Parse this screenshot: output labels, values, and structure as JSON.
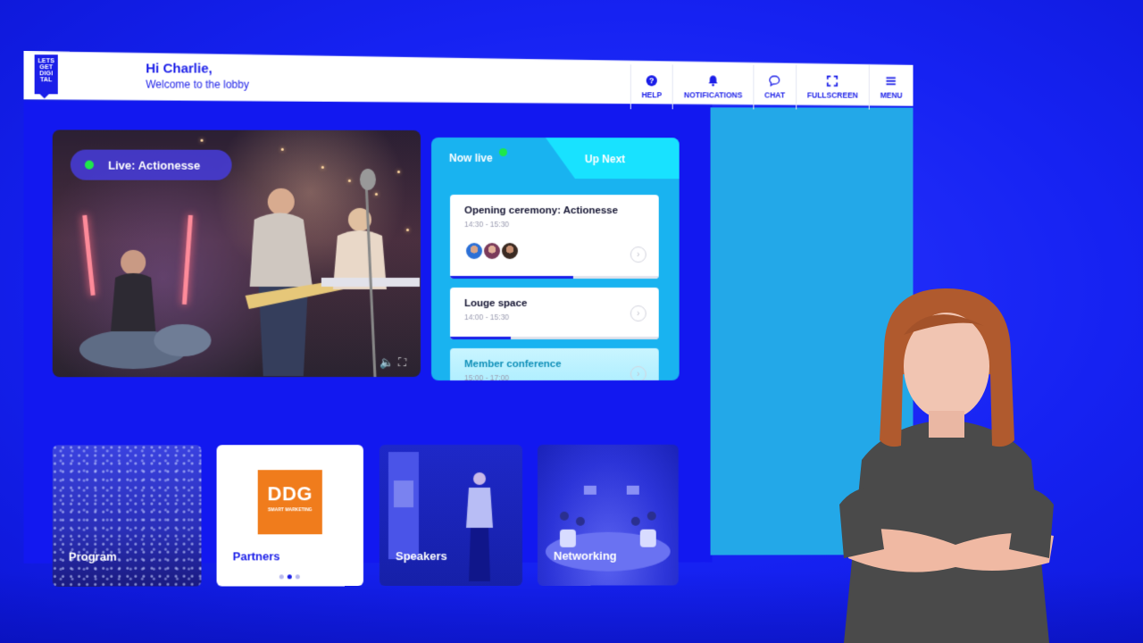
{
  "logo": {
    "text": "LETS GET DIGI TAL"
  },
  "greeting": {
    "title": "Hi Charlie,",
    "subtitle": "Welcome to the lobby"
  },
  "nav": {
    "help": "HELP",
    "notifications": "NOTIFICATIONS",
    "chat": "CHAT",
    "fullscreen": "FULLSCREEN",
    "menu": "MENU"
  },
  "video": {
    "live_label": "Live: Actionesse"
  },
  "schedule": {
    "tab_now": "Now live",
    "tab_next": "Up Next",
    "items": [
      {
        "title": "Opening ceremony: Actionesse",
        "time": "14:30 - 15:30",
        "progress": 0.59
      },
      {
        "title": "Louge space",
        "time": "14:00 - 15:30",
        "progress": 0.29
      },
      {
        "title": "Member conference",
        "time": "15:00 - 17:00"
      }
    ]
  },
  "tiles": {
    "program": "Program",
    "partners": "Partners",
    "partner_logo_big": "DDG",
    "partner_logo_small": "SMART MARKETING",
    "speakers": "Speakers",
    "networking": "Networking"
  },
  "colors": {
    "brand": "#1b1ee8",
    "live": "#1ee84a",
    "accent": "#18e2ff",
    "partner": "#f07c1c"
  }
}
